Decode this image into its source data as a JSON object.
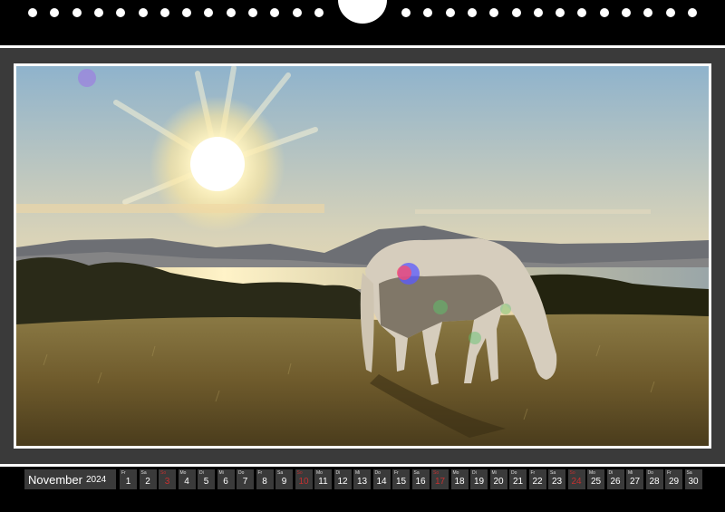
{
  "calendar": {
    "month": "November",
    "year": "2024",
    "days": [
      {
        "wd": "Fr",
        "num": "1"
      },
      {
        "wd": "Sa",
        "num": "2"
      },
      {
        "wd": "So",
        "num": "3",
        "sunday": true
      },
      {
        "wd": "Mo",
        "num": "4"
      },
      {
        "wd": "Di",
        "num": "5"
      },
      {
        "wd": "Mi",
        "num": "6"
      },
      {
        "wd": "Do",
        "num": "7"
      },
      {
        "wd": "Fr",
        "num": "8"
      },
      {
        "wd": "Sa",
        "num": "9"
      },
      {
        "wd": "So",
        "num": "10",
        "sunday": true
      },
      {
        "wd": "Mo",
        "num": "11"
      },
      {
        "wd": "Di",
        "num": "12"
      },
      {
        "wd": "Mi",
        "num": "13"
      },
      {
        "wd": "Do",
        "num": "14"
      },
      {
        "wd": "Fr",
        "num": "15"
      },
      {
        "wd": "Sa",
        "num": "16"
      },
      {
        "wd": "So",
        "num": "17",
        "sunday": true
      },
      {
        "wd": "Mo",
        "num": "18"
      },
      {
        "wd": "Di",
        "num": "19"
      },
      {
        "wd": "Mi",
        "num": "20"
      },
      {
        "wd": "Do",
        "num": "21"
      },
      {
        "wd": "Fr",
        "num": "22"
      },
      {
        "wd": "Sa",
        "num": "23"
      },
      {
        "wd": "So",
        "num": "24",
        "sunday": true
      },
      {
        "wd": "Mo",
        "num": "25"
      },
      {
        "wd": "Di",
        "num": "26"
      },
      {
        "wd": "Mi",
        "num": "27"
      },
      {
        "wd": "Do",
        "num": "28"
      },
      {
        "wd": "Fr",
        "num": "29"
      },
      {
        "wd": "Sa",
        "num": "30"
      }
    ]
  },
  "colors": {
    "background": "#000000",
    "page": "#3a3a3a",
    "sunday": "#c43030",
    "day_text": "#ffffff"
  }
}
